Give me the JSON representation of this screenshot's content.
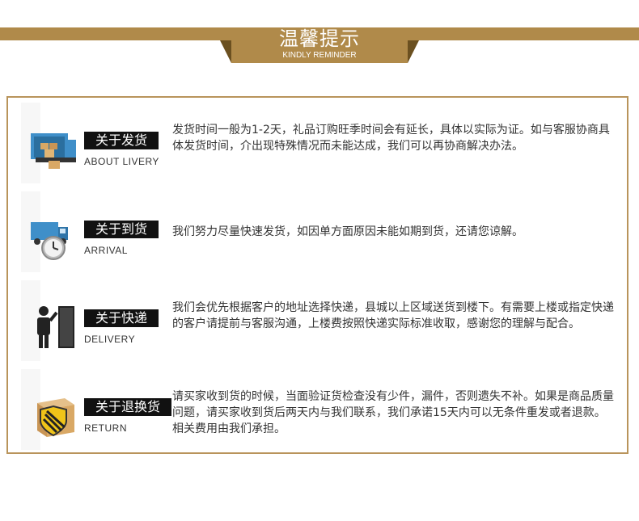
{
  "header": {
    "title": "温馨提示",
    "subtitle": "KINDLY REMINDER"
  },
  "colors": {
    "gold": "#b08a4a",
    "gold_dark": "#8d6c35",
    "border": "#b9945b"
  },
  "items": [
    {
      "title": "关于发货",
      "en": "ABOUT LIVERY",
      "icon": "truck-loaded-icon",
      "text": "发货时间一般为1-2天，礼品订购旺季时间会有延长，具体以实际为证。如与客服协商具体发货时间，介出现特殊情况而未能达成，我们可以再协商解决办法。"
    },
    {
      "title": "关于到货",
      "en": "ARRIVAL",
      "icon": "truck-clock-icon",
      "text": "我们努力尽量快速发货，如因单方面原因未能如期到货，还请您谅解。"
    },
    {
      "title": "关于快递",
      "en": "DELIVERY",
      "icon": "courier-door-icon",
      "text": "我们会优先根据客户的地址选择快递，县城以上区域送货到楼下。有需要上楼或指定快递的客户请提前与客服沟通，上楼费按照快递实际标准收取，感谢您的理解与配合。"
    },
    {
      "title": "关于退换货",
      "en": "RETURN",
      "icon": "box-shield-icon",
      "text": "请买家收到货的时候，当面验证货检查没有少件，漏件，否则遗失不补。如果是商品质量问题，请买家收到货后两天内与我们联系，我们承诺15天内可以无条件重发或者退款。相关费用由我们承担。"
    }
  ]
}
